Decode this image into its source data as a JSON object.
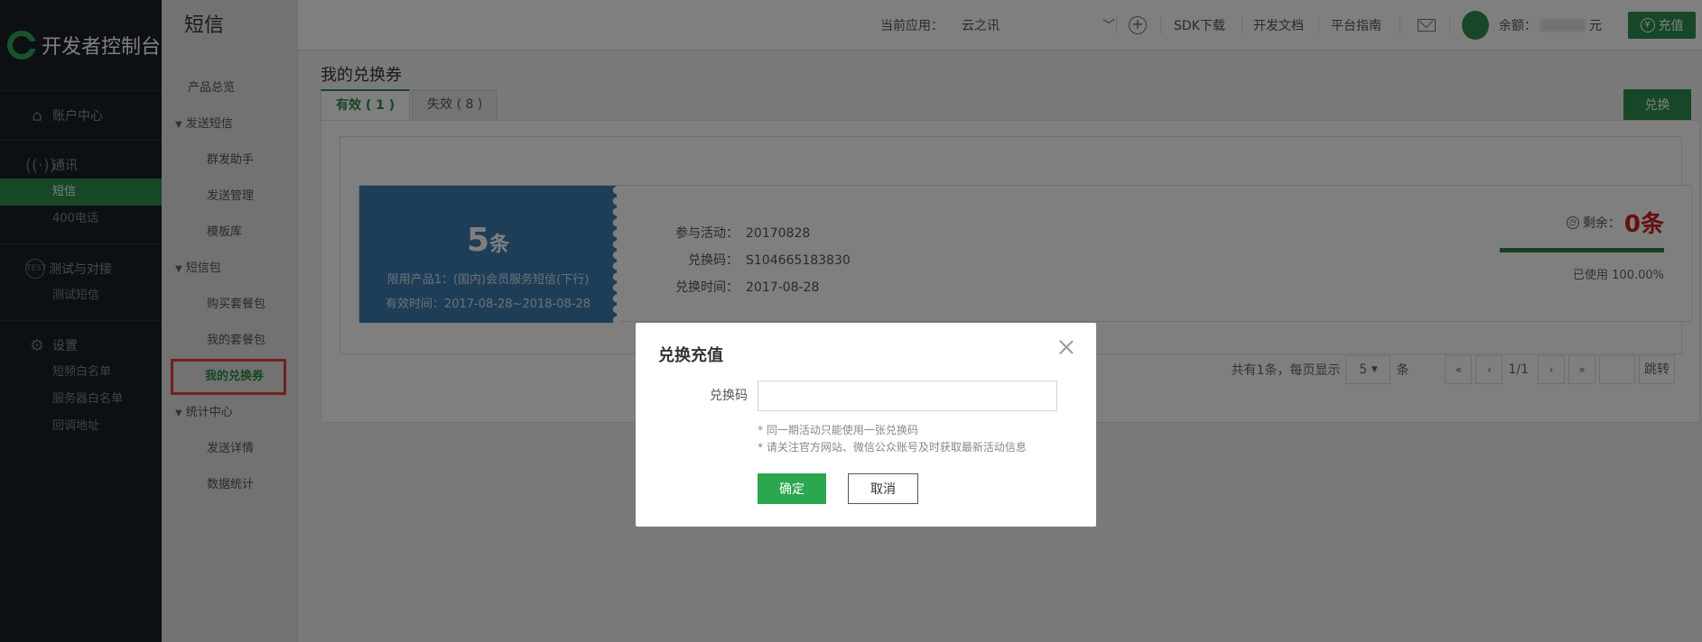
{
  "leftbar": {
    "logo_text": "开发者控制台",
    "groups": [
      {
        "icon": "home-icon",
        "label": "账户中心",
        "items": []
      },
      {
        "icon": "signal-icon",
        "label": "通讯",
        "items": [
          {
            "label": "短信",
            "active": true
          },
          {
            "label": "400电话"
          }
        ]
      },
      {
        "icon": "test-icon",
        "label": "测试与对接",
        "items": [
          {
            "label": "测试短信"
          }
        ]
      },
      {
        "icon": "gear-icon",
        "label": "设置",
        "items": [
          {
            "label": "短频白名单"
          },
          {
            "label": "服务器白名单"
          },
          {
            "label": "回调地址"
          }
        ]
      }
    ]
  },
  "subnav": {
    "title": "短信",
    "overview": "产品总览",
    "send_group": "发送短信",
    "send_items": [
      "群发助手",
      "发送管理",
      "模板库"
    ],
    "pack_group": "短信包",
    "pack_items": [
      "购买套餐包",
      "我的套餐包",
      "我的兑换券"
    ],
    "stats_group": "统计中心",
    "stats_items": [
      "发送详情",
      "数据统计"
    ]
  },
  "topbar": {
    "current_app_label": "当前应用：",
    "current_app_value": "云之讯",
    "sdk": "SDK下载",
    "docs": "开发文档",
    "guide": "平台指南",
    "balance_label": "余额：",
    "balance_unit": "元",
    "recharge": "充值",
    "yuan_symbol": "¥"
  },
  "main": {
    "page_title": "我的兑换券",
    "tab_valid": "有效 ( 1 )",
    "tab_invalid": "失效 ( 8 )",
    "redeem_btn": "兑换",
    "coupon": {
      "count": "5",
      "count_unit": "条",
      "product": "限用产品1：(国内)会员服务短信(下行)",
      "valid_time": "有效时间：2017-08-28~2018-08-28",
      "activity_label": "参与活动：",
      "activity_value": "20170828",
      "code_label": "兑换码：",
      "code_value": "S104665183830",
      "time_label": "兑换时间：",
      "time_value": "2017-08-28",
      "remain_label": "剩余：",
      "remain_value": "0条",
      "used": "已使用 100.00%",
      "used_fraction": 1.0
    },
    "pager": {
      "summary": "共有1条，每页显示",
      "page_size": "5",
      "unit": "条",
      "current": "1/1",
      "go": "跳转"
    }
  },
  "modal": {
    "title": "兑换充值",
    "field_label": "兑换码",
    "field_value": "",
    "hint1": "* 同一期活动只能使用一张兑换码",
    "hint2": "* 请关注官方网站、微信公众账号及时获取最新活动信息",
    "ok": "确定",
    "cancel": "取消"
  }
}
